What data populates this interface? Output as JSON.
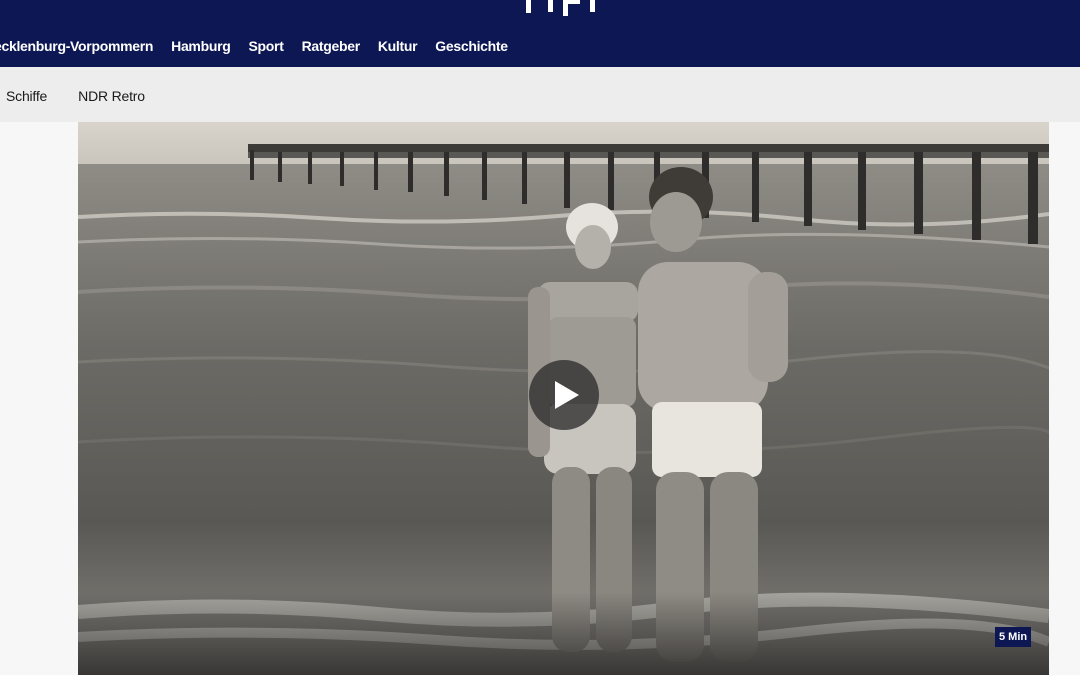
{
  "header": {
    "brand_color": "#0c1754",
    "logo_icon": "ndr-logo-icon",
    "nav": [
      "ecklenburg-Vorpommern",
      "Hamburg",
      "Sport",
      "Ratgeber",
      "Kultur",
      "Geschichte"
    ]
  },
  "subnav": {
    "items": [
      "Schiffe",
      "NDR Retro"
    ]
  },
  "video": {
    "duration": "5 Min",
    "play_icon": "play-icon"
  }
}
